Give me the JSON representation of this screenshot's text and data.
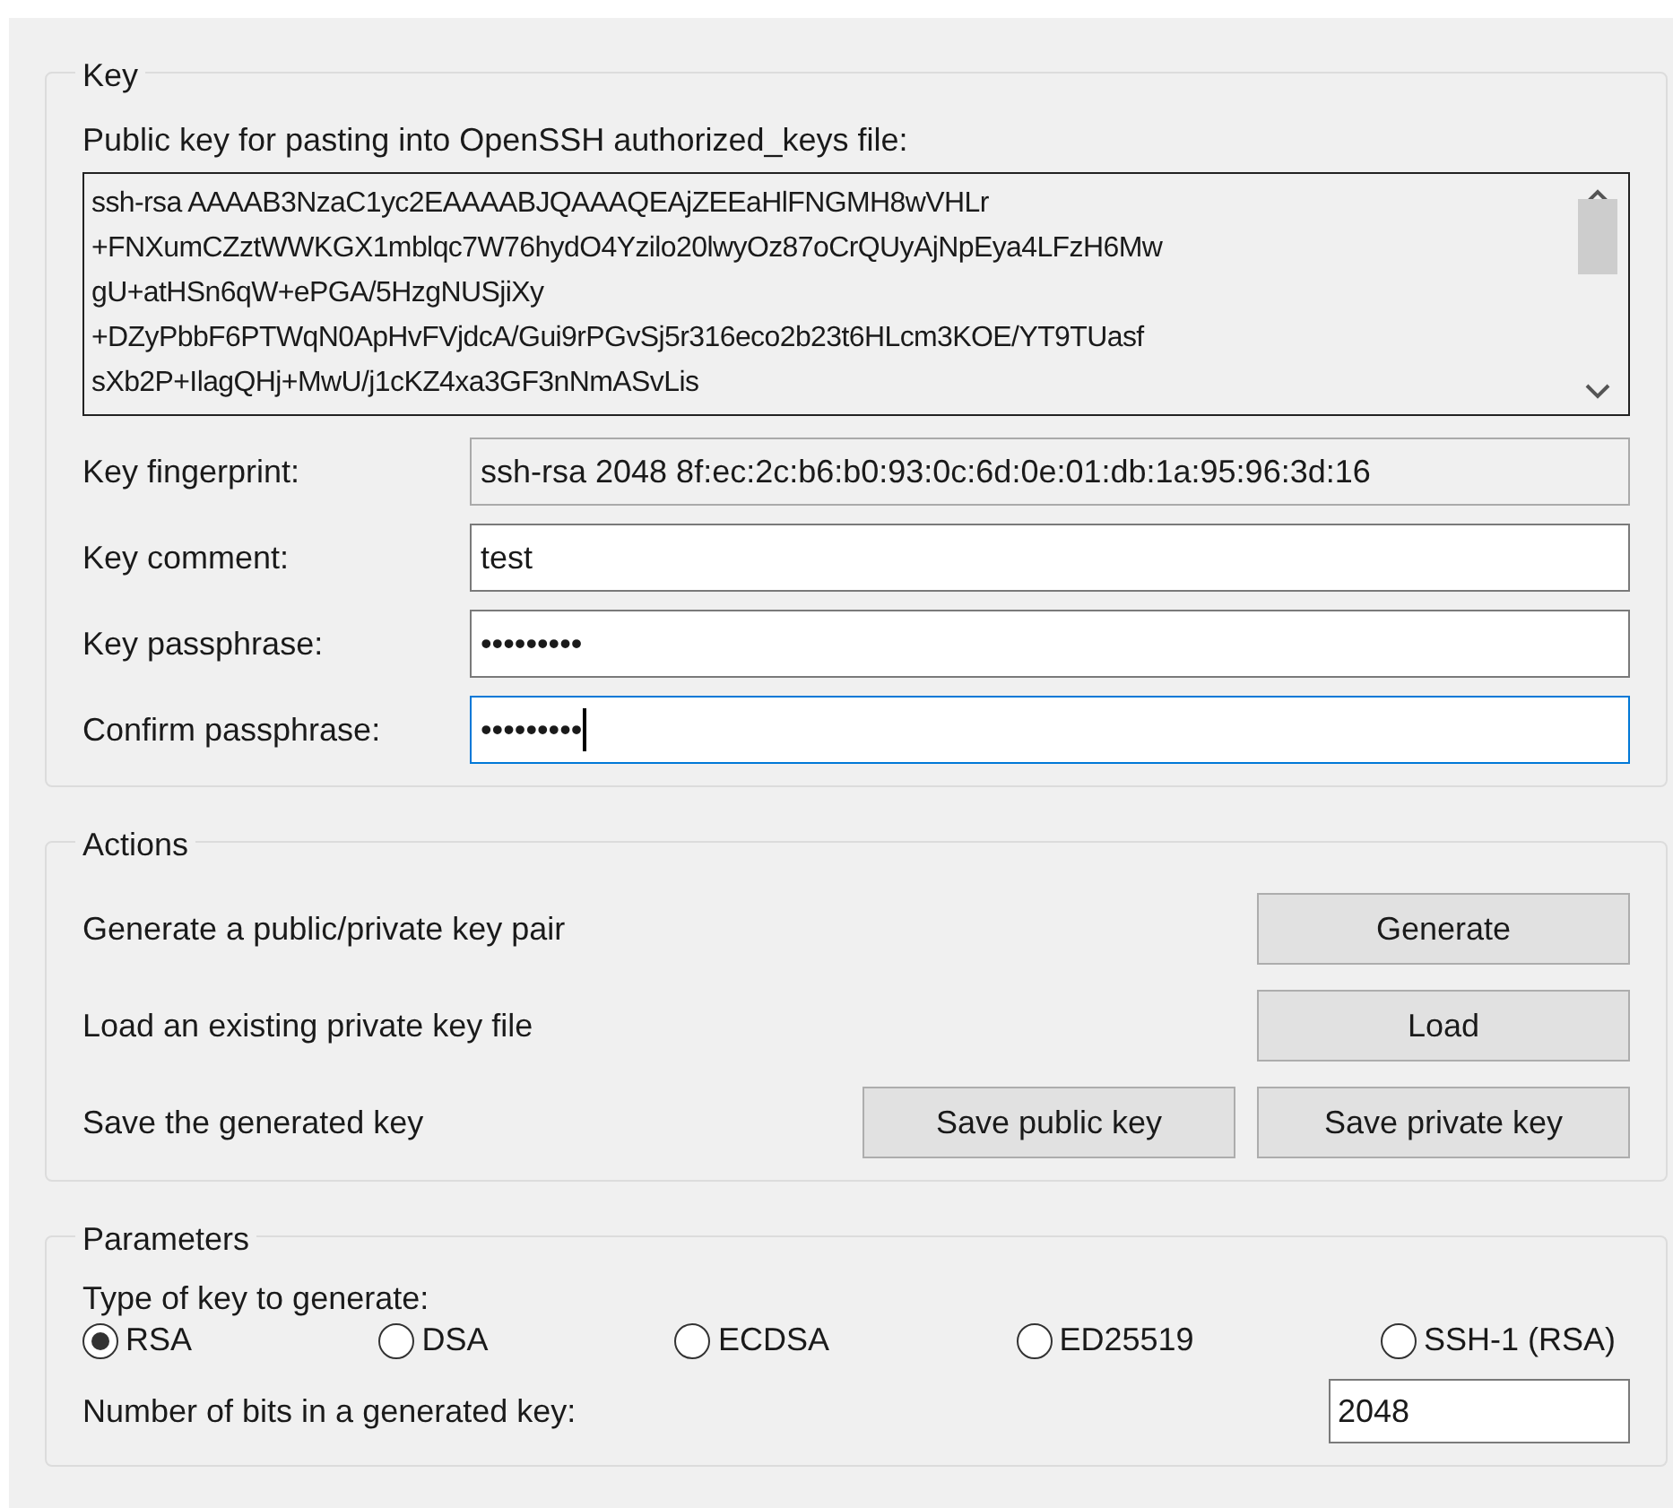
{
  "key_group": {
    "title": "Key",
    "public_key_label": "Public key for pasting into OpenSSH authorized_keys file:",
    "public_key_lines": [
      "ssh-rsa AAAAB3NzaC1yc2EAAAABJQAAAQEAjZEEaHlFNGMH8wVHLr",
      "+FNXumCZztWWKGX1mblqc7W76hydO4Yzilo20lwyOz87oCrQUyAjNpEya4LFzH6Mw",
      "gU+atHSn6qW+ePGA/5HzgNUSjiXy",
      "+DZyPbbF6PTWqN0ApHvFVjdcA/Gui9rPGvSj5r316eco2b23t6HLcm3KOE/YT9TUasf",
      "sXb2P+IlagQHj+MwU/j1cKZ4xa3GF3nNmASvLis"
    ],
    "fields": [
      {
        "label": "Key fingerprint:",
        "value": "ssh-rsa 2048 8f:ec:2c:b6:b0:93:0c:6d:0e:01:db:1a:95:96:3d:16",
        "readonly": true,
        "focused": false
      },
      {
        "label": "Key comment:",
        "value": "test",
        "readonly": false,
        "focused": false
      },
      {
        "label": "Key passphrase:",
        "value": "•••••••••",
        "readonly": false,
        "focused": false
      },
      {
        "label": "Confirm passphrase:",
        "value": "•••••••••",
        "readonly": false,
        "focused": true
      }
    ]
  },
  "actions_group": {
    "title": "Actions",
    "rows": [
      {
        "label": "Generate a public/private key pair",
        "buttons": [
          "Generate"
        ]
      },
      {
        "label": "Load an existing private key file",
        "buttons": [
          "Load"
        ]
      },
      {
        "label": "Save the generated key",
        "buttons": [
          "Save public key",
          "Save private key"
        ]
      }
    ]
  },
  "parameters_group": {
    "title": "Parameters",
    "type_label": "Type of key to generate:",
    "key_types": [
      {
        "label": "RSA",
        "selected": true
      },
      {
        "label": "DSA",
        "selected": false
      },
      {
        "label": "ECDSA",
        "selected": false
      },
      {
        "label": "ED25519",
        "selected": false
      },
      {
        "label": "SSH-1 (RSA)",
        "selected": false
      }
    ],
    "bits_label": "Number of bits in a generated key:",
    "bits_value": "2048"
  }
}
